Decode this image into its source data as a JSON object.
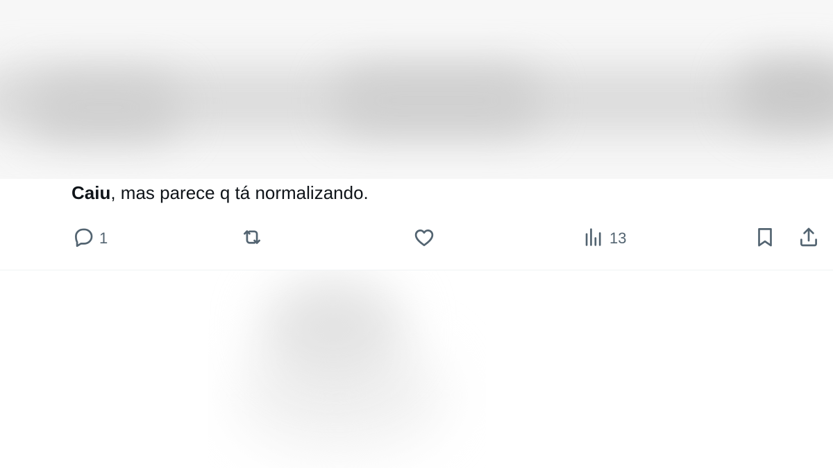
{
  "tweet": {
    "mention": "Caiu",
    "text": ", mas parece q tá normalizando."
  },
  "actions": {
    "reply": {
      "icon": "reply-icon",
      "count": "1"
    },
    "retweet": {
      "icon": "retweet-icon",
      "count": ""
    },
    "like": {
      "icon": "heart-icon",
      "count": ""
    },
    "views": {
      "icon": "views-chart-icon",
      "count": "13"
    },
    "bookmark": {
      "icon": "bookmark-icon"
    },
    "share": {
      "icon": "share-icon"
    }
  },
  "colors": {
    "text": "#0f1419",
    "icon": "#536471",
    "divider": "#eff3f4"
  }
}
